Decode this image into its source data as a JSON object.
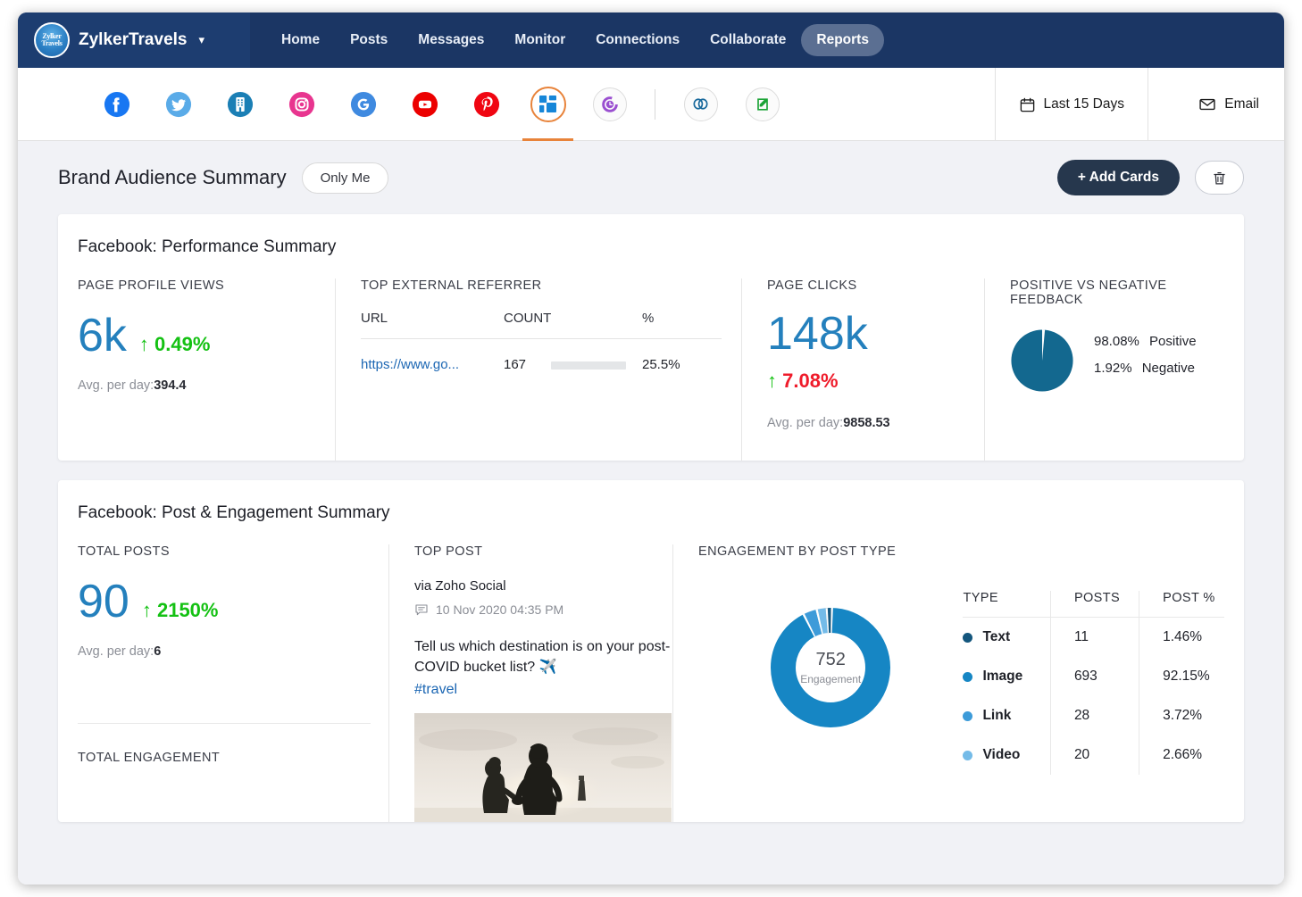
{
  "topnav": {
    "brand": "ZylkerTravels",
    "logo_line1": "Zylker",
    "logo_line2": "Travels",
    "caret": "⌄",
    "links": [
      {
        "label": "Home",
        "active": false
      },
      {
        "label": "Posts",
        "active": false
      },
      {
        "label": "Messages",
        "active": false
      },
      {
        "label": "Monitor",
        "active": false
      },
      {
        "label": "Connections",
        "active": false
      },
      {
        "label": "Collaborate",
        "active": false
      },
      {
        "label": "Reports",
        "active": true
      }
    ]
  },
  "channelbar": {
    "channels": [
      {
        "name": "facebook-channel-icon",
        "selected": false
      },
      {
        "name": "twitter-channel-icon",
        "selected": false
      },
      {
        "name": "linkedin-company-channel-icon",
        "selected": false
      },
      {
        "name": "instagram-channel-icon",
        "selected": false
      },
      {
        "name": "google-business-channel-icon",
        "selected": false
      },
      {
        "name": "youtube-channel-icon",
        "selected": false
      },
      {
        "name": "pinterest-channel-icon",
        "selected": false
      },
      {
        "name": "all-channels-grid-icon",
        "selected": true
      },
      {
        "name": "scheduled-clock-icon",
        "selected": false
      },
      {
        "name": "zoho-crm-link-icon",
        "selected": false
      },
      {
        "name": "zoho-desk-icon",
        "selected": false
      }
    ],
    "date_range": "Last 15 Days",
    "email_label": "Email"
  },
  "page_header": {
    "title": "Brand Audience Summary",
    "visibility": "Only Me",
    "add_cards": "+ Add Cards",
    "delete_icon": "trash-icon"
  },
  "performance": {
    "title": "Facebook: Performance Summary",
    "page_profile_views": {
      "label": "PAGE PROFILE VIEWS",
      "value": "6k",
      "delta": "0.49%",
      "delta_direction": "↑",
      "delta_color": "#14c113",
      "avg_label": "Avg. per day:",
      "avg_value": "394.4"
    },
    "top_referrer": {
      "label": "TOP EXTERNAL REFERRER",
      "columns": [
        "URL",
        "COUNT",
        "%"
      ],
      "rows": [
        {
          "url": "https://www.go...",
          "count": "167",
          "pct": "25.5%",
          "bar_fill": 28
        }
      ]
    },
    "page_clicks": {
      "label": "PAGE CLICKS",
      "value": "148k",
      "delta": "7.08%",
      "delta_direction": "↑",
      "delta_color": "#ef1b2a",
      "avg_label": "Avg. per day:",
      "avg_value": "9858.53"
    },
    "feedback": {
      "label": "POSITIVE VS NEGATIVE FEEDBACK",
      "positive_pct": "98.08%",
      "positive_label": "Positive",
      "negative_pct": "1.92%",
      "negative_label": "Negative",
      "positive_color": "#13688f",
      "negative_color": "#ffffff"
    }
  },
  "engagement": {
    "title": "Facebook: Post & Engagement Summary",
    "total_posts": {
      "label": "TOTAL POSTS",
      "value": "90",
      "delta": "2150%",
      "delta_direction": "↑",
      "avg_label": "Avg. per day:",
      "avg_value": "6"
    },
    "total_engagement_label": "TOTAL ENGAGEMENT",
    "top_post": {
      "label": "TOP POST",
      "via": "via Zoho Social",
      "timestamp": "10 Nov 2020 04:35 PM",
      "text": "Tell us which destination is on your post-COVID bucket list? ✈️",
      "hashtag": "#travel",
      "image_alt": "couple-silhouette-sunset-photo"
    },
    "by_post_type": {
      "label": "ENGAGEMENT BY POST TYPE",
      "center_value": "752",
      "center_caption": "Engagement",
      "columns": [
        "TYPE",
        "POSTS",
        "POST %"
      ],
      "rows": [
        {
          "type": "Text",
          "posts": "11",
          "pct": "1.46%",
          "color": "#14567d"
        },
        {
          "type": "Image",
          "posts": "693",
          "pct": "92.15%",
          "color": "#1686c4"
        },
        {
          "type": "Link",
          "posts": "28",
          "pct": "3.72%",
          "color": "#3d9bd9"
        },
        {
          "type": "Video",
          "posts": "20",
          "pct": "2.66%",
          "color": "#74bbe8"
        }
      ]
    }
  },
  "chart_data": [
    {
      "type": "pie",
      "title": "POSITIVE VS NEGATIVE FEEDBACK",
      "labels": [
        "Positive",
        "Negative"
      ],
      "values": [
        98.08,
        1.92
      ],
      "colors": [
        "#13688f",
        "#ffffff"
      ],
      "unit": "%",
      "legend": "right"
    },
    {
      "type": "pie",
      "title": "ENGAGEMENT BY POST TYPE",
      "subtype": "donut",
      "center_value": 752,
      "center_caption": "Engagement",
      "labels": [
        "Text",
        "Image",
        "Link",
        "Video"
      ],
      "values": [
        1.46,
        92.15,
        3.72,
        2.66
      ],
      "counts": [
        11,
        693,
        28,
        20
      ],
      "colors": [
        "#14567d",
        "#1686c4",
        "#3d9bd9",
        "#74bbe8"
      ],
      "unit": "%",
      "legend": "right-table"
    },
    {
      "type": "bar",
      "title": "TOP EXTERNAL REFERRER",
      "orientation": "horizontal",
      "categories": [
        "https://www.go..."
      ],
      "values": [
        25.5
      ],
      "counts": [
        167
      ],
      "ylabel": "%",
      "xlim": [
        0,
        100
      ]
    }
  ]
}
